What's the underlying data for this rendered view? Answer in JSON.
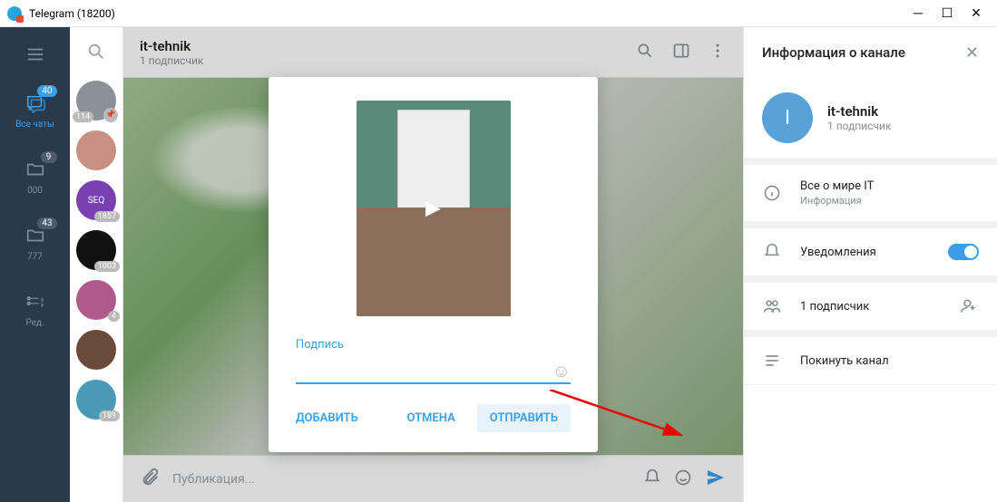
{
  "window": {
    "title": "Telegram (18200)"
  },
  "rail": {
    "all_chats_label": "Все чаты",
    "all_chats_badge": "40",
    "folder1_label": "000",
    "folder1_badge": "9",
    "folder2_label": "777",
    "folder2_badge": "43",
    "edit_label": "Ред."
  },
  "chatlist": {
    "items": [
      {
        "badge": "114",
        "color": "#8a9199",
        "pinned": true
      },
      {
        "badge": "",
        "color": "#c89080"
      },
      {
        "badge": "1857",
        "color": "#7a3fb0",
        "text": "SEQ"
      },
      {
        "badge": "1003",
        "color": "#111"
      },
      {
        "badge": "4",
        "color": "#b05a8a"
      },
      {
        "badge": "",
        "color": "#6a4a3a"
      },
      {
        "badge": "189",
        "color": "#4a9ab5"
      }
    ]
  },
  "chat": {
    "title": "it-tehnik",
    "subtitle": "1 подписчик",
    "composer_placeholder": "Публикация..."
  },
  "modal": {
    "caption": "Подпись",
    "add": "ДОБАВИТЬ",
    "cancel": "ОТМЕНА",
    "send": "ОТПРАВИТЬ"
  },
  "info": {
    "header": "Информация о канале",
    "name": "it-tehnik",
    "subtitle": "1 подписчик",
    "about_title": "Все о мире IT",
    "about_sub": "Информация",
    "notifications": "Уведомления",
    "subscribers": "1 подписчик",
    "leave": "Покинуть канал",
    "avatar_letter": "I"
  }
}
